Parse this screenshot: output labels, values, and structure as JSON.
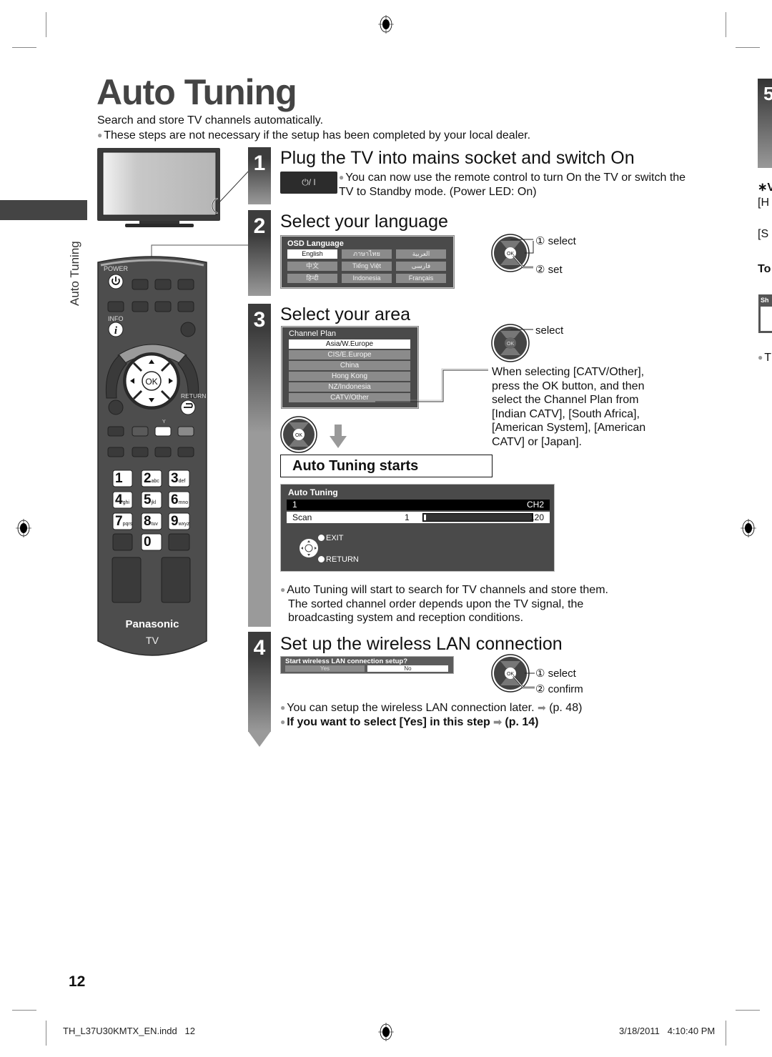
{
  "page": {
    "title": "Auto Tuning",
    "intro": "Search and store TV channels automatically.",
    "intro_note": "These steps are not necessary if the setup has been completed by your local dealer.",
    "side_label": "Auto Tuning",
    "page_number": "12"
  },
  "right_edge": {
    "tab_number": "5",
    "fragments": [
      "∗V",
      "[H",
      "[S",
      "To",
      "Sh",
      "T"
    ]
  },
  "remote": {
    "power_label": "POWER",
    "info_label": "INFO",
    "ok_label": "OK",
    "return_label": "RETURN",
    "y_label": "Y",
    "keys": [
      {
        "num": "1",
        "sub": ""
      },
      {
        "num": "2",
        "sub": "abc"
      },
      {
        "num": "3",
        "sub": "def"
      },
      {
        "num": "4",
        "sub": "ghi"
      },
      {
        "num": "5",
        "sub": "jkl"
      },
      {
        "num": "6",
        "sub": "mno"
      },
      {
        "num": "7",
        "sub": "pqrs"
      },
      {
        "num": "8",
        "sub": "tuv"
      },
      {
        "num": "9",
        "sub": "wxyz"
      },
      {
        "num": "0",
        "sub": ""
      }
    ],
    "brand": "Panasonic",
    "model": "TV"
  },
  "steps": [
    {
      "number": "1",
      "heading": "Plug the TV into mains socket and switch On",
      "button_label": "⏻/ I",
      "note": "You can now use the remote control to turn On the TV or switch the TV to Standby mode. (Power LED: On)"
    },
    {
      "number": "2",
      "heading": "Select your language",
      "osd_title": "OSD Language",
      "languages": [
        "English",
        "ภาษาไทย",
        "العربية",
        "中文",
        "Tiếng Việt",
        "فارسی",
        "हिन्दी",
        "Indonesia",
        "Français"
      ],
      "selected_language": "English",
      "dpad_labels": [
        "① select",
        "② set"
      ]
    },
    {
      "number": "3",
      "heading": "Select your area",
      "osd_title": "Channel Plan",
      "plans": [
        "Asia/W.Europe",
        "CIS/E.Europe",
        "China",
        "Hong Kong",
        "NZ/Indonesia",
        "CATV/Other"
      ],
      "selected_plan": "Asia/W.Europe",
      "dpad_label": "select",
      "catv_note": "When selecting [CATV/Other], press the OK button, and then select the Channel Plan from [Indian CATV], [South Africa], [American System], [American CATV] or [Japan].",
      "starts_label": "Auto Tuning starts",
      "tuning_osd": {
        "title": "Auto Tuning",
        "row_index": "1",
        "row_channel": "CH2",
        "scan_label": "Scan",
        "scan_min": "1",
        "scan_max": "120",
        "scan_progress": 1,
        "exit_label": "EXIT",
        "return_label": "RETURN"
      },
      "notes": [
        "Auto Tuning will start to search for TV channels and store them.",
        "The sorted channel order depends upon the TV signal, the",
        "broadcasting system and reception conditions."
      ]
    },
    {
      "number": "4",
      "heading": "Set up the wireless LAN connection",
      "osd_question": "Start wireless LAN connection setup?",
      "yes_label": "Yes",
      "no_label": "No",
      "dpad_labels": [
        "① select",
        "② confirm"
      ],
      "note1": "You can setup the wireless LAN connection later.",
      "note1_ref": "(p. 48)",
      "note2": "If you want to select [Yes] in this step",
      "note2_ref": "(p. 14)"
    }
  ],
  "footer": {
    "file": "TH_L37U30KMTX_EN.indd   12",
    "timestamp": "3/18/2011   4:10:40 PM"
  },
  "colors": {
    "step_dark": "#3c3c3c",
    "step_light": "#9a9a9a",
    "osd_bg": "#4a4a4a",
    "remote_body": "#4d4d4d"
  }
}
